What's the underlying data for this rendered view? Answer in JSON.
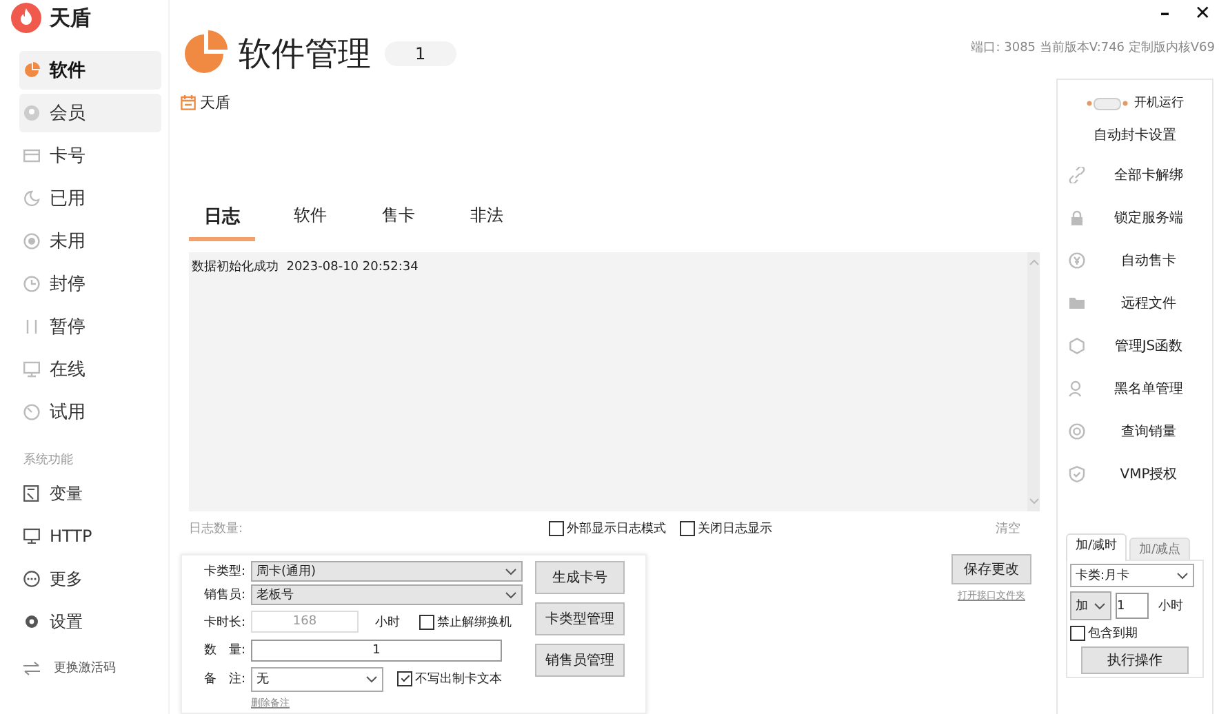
{
  "app": {
    "name": "天盾"
  },
  "window_controls": [
    "–",
    "✕"
  ],
  "sidebar": {
    "items": [
      {
        "label": "软件",
        "selected": true,
        "highlighted": true
      },
      {
        "label": "会员",
        "selected": false,
        "highlighted": true
      },
      {
        "label": "卡号",
        "selected": false,
        "highlighted": false
      },
      {
        "label": "已用",
        "selected": false,
        "highlighted": false
      },
      {
        "label": "未用",
        "selected": false,
        "highlighted": false
      },
      {
        "label": "封停",
        "selected": false,
        "highlighted": false
      },
      {
        "label": "暂停",
        "selected": false,
        "highlighted": false
      },
      {
        "label": "在线",
        "selected": false,
        "highlighted": false
      },
      {
        "label": "试用",
        "selected": false,
        "highlighted": false
      }
    ],
    "section_title": "系统功能",
    "system_items": [
      "变量",
      "HTTP",
      "更多",
      "设置"
    ],
    "footer": "更换激活码"
  },
  "version_info": "端口: 3085  当前版本V:746 定制版内核V69",
  "page": {
    "title": "软件管理",
    "badge": "1",
    "subtitle": "天盾"
  },
  "tabs": [
    {
      "label": "日志",
      "selected": true
    },
    {
      "label": "软件",
      "selected": false
    },
    {
      "label": "售卡",
      "selected": false
    },
    {
      "label": "非法",
      "selected": false
    }
  ],
  "log": {
    "lines": [
      "数据初始化成功  2023-08-10 20:52:34"
    ],
    "count_label": "日志数量:",
    "options": [
      {
        "label": "外部显示日志模式",
        "checked": false
      },
      {
        "label": "关闭日志显示",
        "checked": false
      }
    ],
    "clear": "清空"
  },
  "card_form": {
    "card_type": {
      "label": "卡类型:",
      "value": "周卡(通用)"
    },
    "seller": {
      "label": "销售员:",
      "value": "老板号"
    },
    "duration": {
      "label": "卡时长:",
      "value": "168",
      "unit": "小时",
      "disabled": true
    },
    "unbind_option": {
      "label": "禁止解绑换机",
      "checked": false
    },
    "quantity": {
      "label": "数　量:",
      "value": "1"
    },
    "remark": {
      "label": "备　注:",
      "value": "无"
    },
    "no_text_option": {
      "label": "不写出制卡文本",
      "checked": true
    },
    "delete_remark": "删除备注",
    "buttons": [
      "生成卡号",
      "卡类型管理",
      "销售员管理"
    ]
  },
  "save": {
    "button": "保存更改",
    "link": "打开接口文件夹"
  },
  "right_panel": {
    "startup": {
      "label": "开机运行",
      "on": false
    },
    "auto_ban": "自动封卡设置",
    "actions": [
      "全部卡解绑",
      "锁定服务端",
      "自动售卡",
      "远程文件",
      "管理JS函数",
      "黑名单管理",
      "查询销量",
      "VMP授权"
    ],
    "adjust": {
      "tabs": [
        {
          "label": "加/减时",
          "selected": true
        },
        {
          "label": "加/减点",
          "selected": false
        }
      ],
      "card_type": "卡类:月卡",
      "operation": "加",
      "amount": "1",
      "unit": "小时",
      "include_expired": {
        "label": "包含到期",
        "checked": false
      },
      "execute": "执行操作"
    }
  }
}
